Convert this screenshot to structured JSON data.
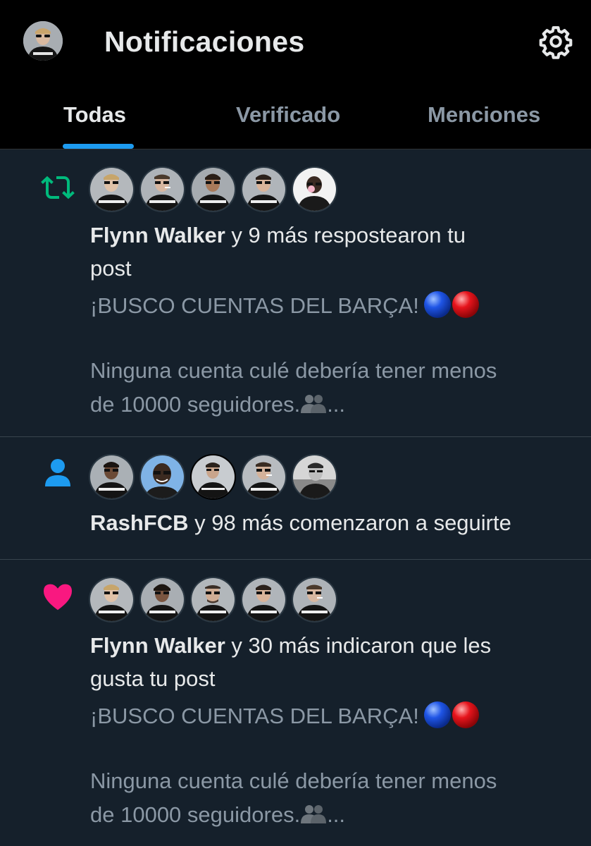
{
  "header": {
    "title": "Notificaciones",
    "tabs": [
      {
        "label": "Todas",
        "active": true
      },
      {
        "label": "Verificado",
        "active": false
      },
      {
        "label": "Menciones",
        "active": false
      }
    ],
    "accent_color": "#1d9bf0"
  },
  "notifications": [
    {
      "type": "repost",
      "icon": "repost-icon",
      "icon_color": "#00ba7c",
      "actor": "Flynn Walker",
      "action_line1": " y 9 más respostearon tu",
      "action_line2": "post",
      "post_title": "¡BUSCO CUENTAS DEL BARÇA!",
      "post_body_line1": "Ninguna cuenta culé debería tener menos",
      "post_body_line2": "de 10000 seguidores.",
      "ellipsis": "..."
    },
    {
      "type": "follow",
      "icon": "person-icon",
      "icon_color": "#1d9bf0",
      "actor": "RashFCB",
      "action_line1": " y 98 más comenzaron a seguirte"
    },
    {
      "type": "like",
      "icon": "heart-icon",
      "icon_color": "#f91880",
      "actor": "Flynn Walker",
      "action_line1": " y 30 más indicaron que les",
      "action_line2": "gusta tu post",
      "post_title": "¡BUSCO CUENTAS DEL BARÇA!",
      "post_body_line1": "Ninguna cuenta culé debería tener menos",
      "post_body_line2": "de 10000 seguidores.",
      "ellipsis": "..."
    }
  ]
}
